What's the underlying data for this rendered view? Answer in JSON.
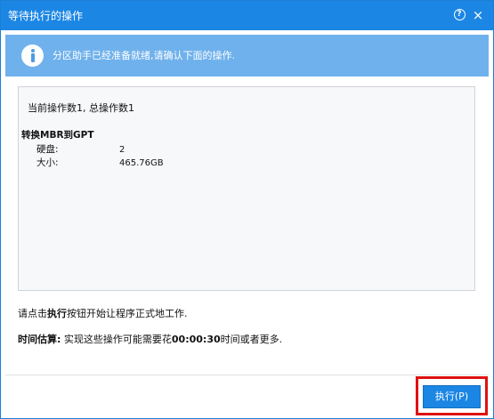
{
  "window": {
    "title": "等待执行的操作",
    "help_glyph": "?",
    "close_glyph": "×"
  },
  "banner": {
    "icon": "info-icon",
    "text": "分区助手已经准备就绪,请确认下面的操作."
  },
  "operations": {
    "count_text": "当前操作数1, 总操作数1",
    "items": [
      {
        "title": "转换MBR到GPT",
        "rows": [
          {
            "label": "硬盘:",
            "value": "2"
          },
          {
            "label": "大小:",
            "value": "465.76GB"
          }
        ]
      }
    ]
  },
  "instruction": {
    "prefix": "请点击",
    "bold": "执行",
    "suffix": "按钮开始让程序正式地工作."
  },
  "estimate": {
    "label": "时间估算:",
    "prefix": " 实现这些操作可能需要花",
    "time": "00:00:30",
    "suffix": "时间或者更多."
  },
  "footer": {
    "execute_label": "执行(P)"
  },
  "colors": {
    "titlebar": "#1b86e4",
    "banner": "#6fb1ec",
    "highlight": "#e01010"
  }
}
